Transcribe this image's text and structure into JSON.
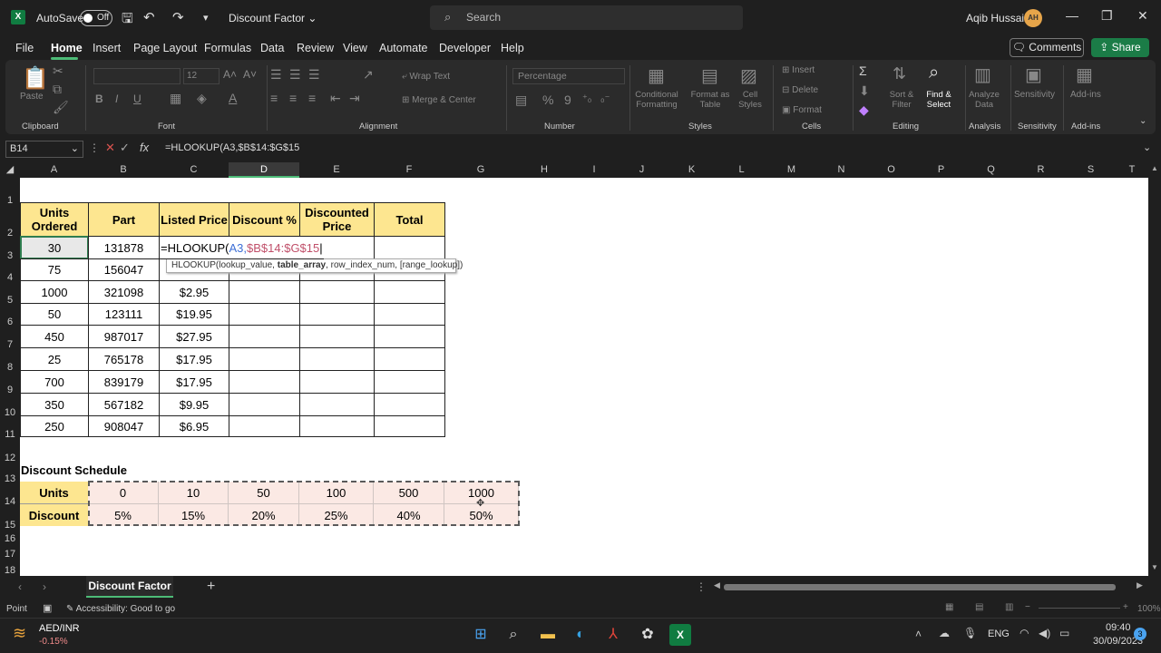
{
  "title": {
    "autosave": "AutoSave",
    "toggle": "Off",
    "doc": "Discount Factor",
    "search": "Search",
    "user": "Aqib Hussain",
    "initials": "AH"
  },
  "menu": {
    "file": "File",
    "home": "Home",
    "insert": "Insert",
    "page_layout": "Page Layout",
    "formulas": "Formulas",
    "data": "Data",
    "review": "Review",
    "view": "View",
    "automate": "Automate",
    "developer": "Developer",
    "help": "Help",
    "comments": "Comments",
    "share": "Share"
  },
  "ribbon": {
    "clipboard": "Clipboard",
    "paste": "Paste",
    "font": "Font",
    "font_size": "12",
    "alignment": "Alignment",
    "wrap_text": "Wrap Text",
    "merge_center": "Merge & Center",
    "number": "Number",
    "number_format": "Percentage",
    "styles": "Styles",
    "cond_format": "Conditional Formatting",
    "format_table": "Format as Table",
    "cell_styles": "Cell Styles",
    "cells": "Cells",
    "insert": "Insert",
    "delete": "Delete",
    "format": "Format",
    "editing": "Editing",
    "sort_filter": "Sort & Filter",
    "find_select": "Find & Select",
    "analysis": "Analysis",
    "analyze_data": "Analyze Data",
    "sensitivity": "Sensitivity",
    "addins": "Add-ins"
  },
  "formula_bar": {
    "name_box": "B14",
    "formula": "=HLOOKUP(A3,$B$14:$G$15"
  },
  "columns": [
    "A",
    "B",
    "C",
    "D",
    "E",
    "F",
    "G",
    "H",
    "I",
    "J",
    "K",
    "L",
    "M",
    "N",
    "O",
    "P",
    "Q",
    "R",
    "S",
    "T"
  ],
  "rows": [
    "1",
    "2",
    "3",
    "4",
    "5",
    "6",
    "7",
    "8",
    "9",
    "10",
    "11",
    "12",
    "13",
    "14",
    "15",
    "16",
    "17",
    "18"
  ],
  "table": {
    "headers": [
      "Units Ordered",
      "Part",
      "Listed Price",
      "Discount %",
      "Discounted Price",
      "Total"
    ],
    "rows": [
      [
        "30",
        "131878",
        "=HLOOKUP(A3,$B$14:$G$15",
        "",
        "",
        ""
      ],
      [
        "75",
        "156047",
        "",
        "",
        "",
        ""
      ],
      [
        "1000",
        "321098",
        "$2.95",
        "",
        "",
        ""
      ],
      [
        "50",
        "123111",
        "$19.95",
        "",
        "",
        ""
      ],
      [
        "450",
        "987017",
        "$27.95",
        "",
        "",
        ""
      ],
      [
        "25",
        "765178",
        "$17.95",
        "",
        "",
        ""
      ],
      [
        "700",
        "839179",
        "$17.95",
        "",
        "",
        ""
      ],
      [
        "350",
        "567182",
        "$9.95",
        "",
        "",
        ""
      ],
      [
        "250",
        "908047",
        "$6.95",
        "",
        "",
        ""
      ]
    ]
  },
  "schedule": {
    "title": "Discount Schedule",
    "units_label": "Units",
    "discount_label": "Discount",
    "units": [
      "0",
      "10",
      "50",
      "100",
      "500",
      "1000"
    ],
    "discounts": [
      "5%",
      "15%",
      "20%",
      "25%",
      "40%",
      "50%"
    ]
  },
  "tooltip": {
    "prefix": "HLOOKUP(lookup_value, ",
    "bold": "table_array",
    "suffix": ", row_index_num, [range_lookup])"
  },
  "formula_parts": {
    "a": "=HLOOKUP(",
    "b": "A3,",
    "c": "$B$14:$G$15"
  },
  "sheet_tab": "Discount Factor",
  "status": {
    "mode": "Point",
    "accessibility": "Accessibility: Good to go",
    "zoom": "100%"
  },
  "taskbar": {
    "ticker": "AED/INR",
    "change": "-0.15%",
    "lang": "ENG",
    "time": "09:40",
    "date": "30/09/2023",
    "notif": "3"
  }
}
